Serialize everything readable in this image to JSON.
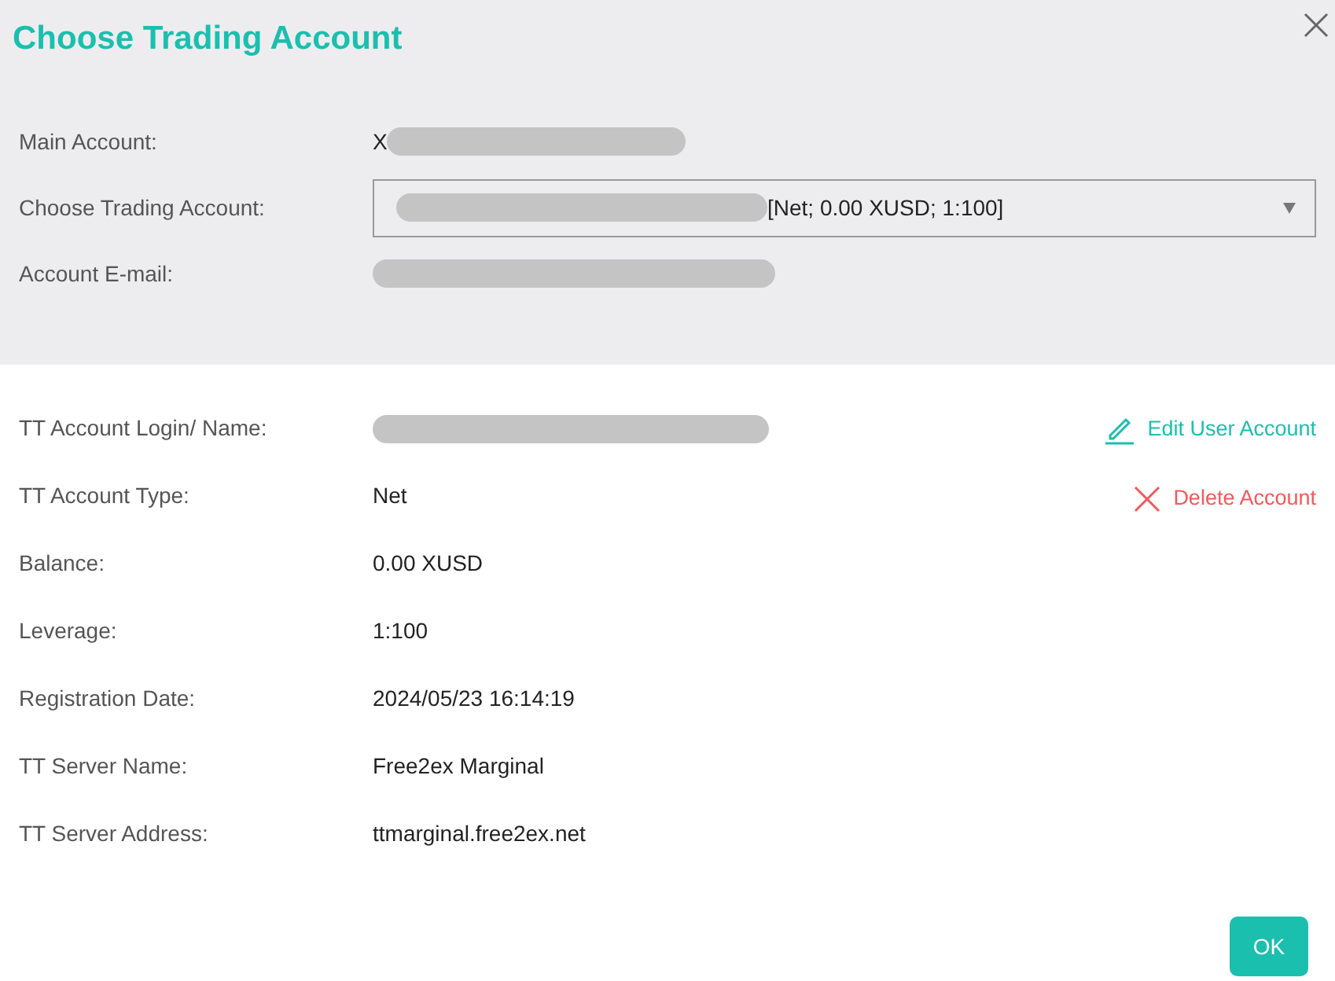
{
  "title": "Choose Trading Account",
  "account_fields": [
    {
      "kind": "text",
      "label": "Main Account:",
      "value": "X"
    },
    {
      "kind": "select",
      "label": "Choose Trading Account:",
      "value": "[Net; 0.00 XUSD; 1:100]"
    },
    {
      "kind": "email",
      "label": "Account E-mail:"
    }
  ],
  "details": [
    {
      "label": "TT Account Login/ Name:"
    },
    {
      "label": "TT Account Type:",
      "value": "Net"
    },
    {
      "label": "Balance:",
      "value": "0.00 XUSD"
    },
    {
      "label": "Leverage:",
      "value": "1:100"
    },
    {
      "label": "Registration Date:",
      "value": "2024/05/23 16:14:19"
    },
    {
      "label": "TT Server Name:",
      "value": "Free2ex Marginal"
    },
    {
      "label": "TT Server Address:",
      "value": "ttmarginal.free2ex.net"
    }
  ],
  "actions": [
    {
      "kind": "edit",
      "label": "Edit User Account"
    },
    {
      "kind": "delete",
      "label": "Delete Account"
    }
  ],
  "ok_button": "OK"
}
